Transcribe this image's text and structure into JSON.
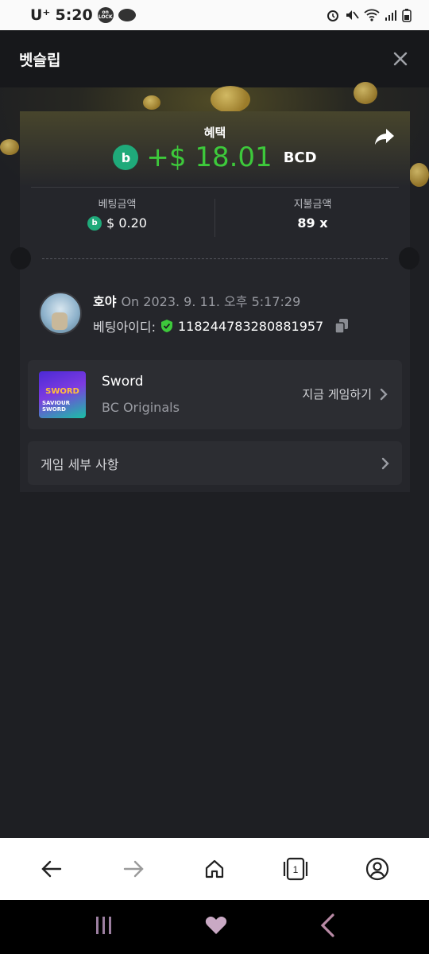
{
  "status_bar": {
    "carrier": "U⁺",
    "time": "5:20",
    "lock_badge": "on LOCK"
  },
  "header": {
    "title": "벳슬립"
  },
  "bet_card": {
    "benefit_label": "혜택",
    "profit_amount": "+$ 18.01",
    "profit_currency": "BCD",
    "bet_amount_label": "베팅금액",
    "bet_amount_value": "$ 0.20",
    "payout_label": "지불금액",
    "payout_value": "89 x"
  },
  "user": {
    "name": "호야",
    "timestamp": "On 2023. 9. 11. 오후 5:17:29",
    "bet_id_label": "베팅아이디:",
    "bet_id": "118244783280881957"
  },
  "game": {
    "name": "Sword",
    "provider": "BC Originals",
    "thumb_title": "SWORD",
    "thumb_subtitle": "SAVIOUR SWORD",
    "play_now_label": "지금 게임하기"
  },
  "details": {
    "label": "게임 세부 사항"
  },
  "browser_nav": {
    "tab_count": "1"
  },
  "colors": {
    "accent_green": "#3dc93b",
    "bc_logo": "#1faa7a",
    "panel": "#25262b"
  }
}
